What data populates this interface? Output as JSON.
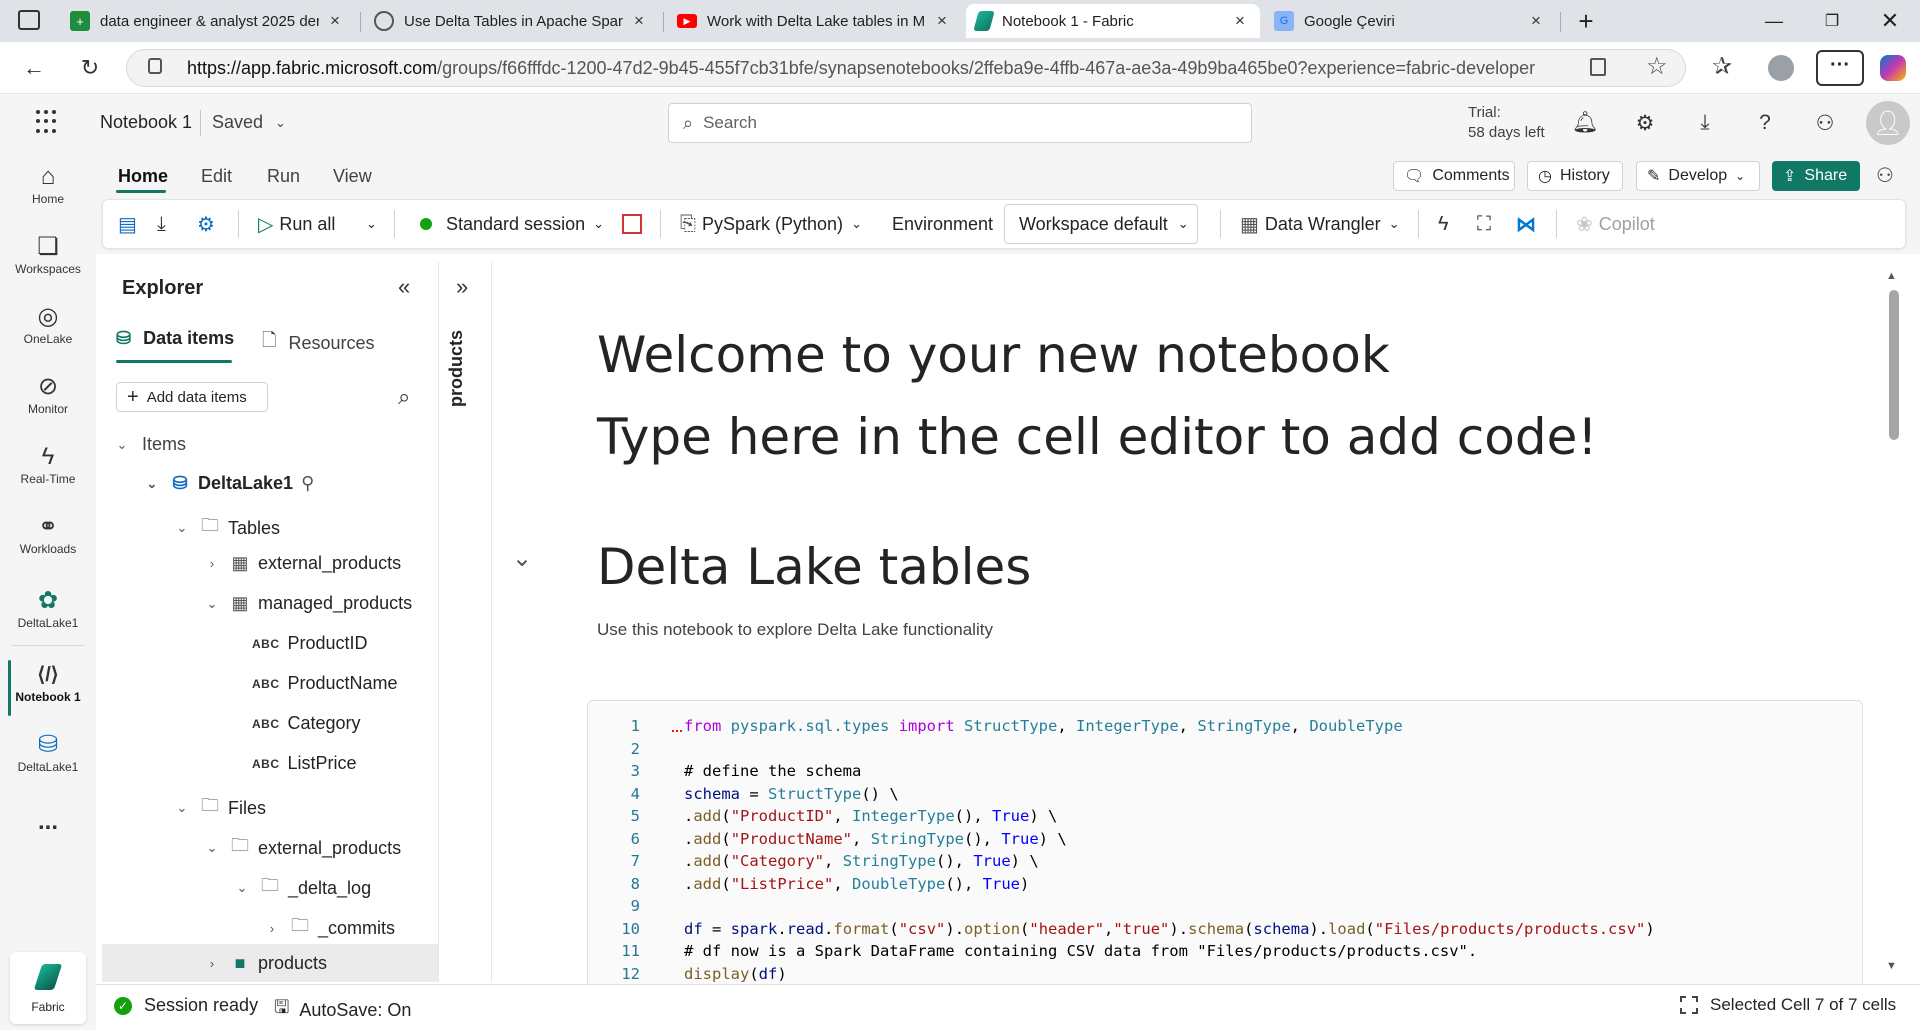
{
  "browser": {
    "tabs": [
      {
        "title": "data engineer & analyst 2025 den",
        "icon": "sheets-icon",
        "color": "#1e8e3e"
      },
      {
        "title": "Use Delta Tables in Apache Spark",
        "icon": "globe-icon",
        "color": "#555555"
      },
      {
        "title": "Work with Delta Lake tables in Mi",
        "icon": "youtube-icon",
        "color": "#ff0000"
      },
      {
        "title": "Notebook 1 - Fabric",
        "icon": "fabric-icon",
        "color": "#117865"
      },
      {
        "title": "Google Çeviri",
        "icon": "translate-icon",
        "color": "#4285f4"
      }
    ],
    "url_domain": "https://app.fabric.microsoft.com",
    "url_path": "/groups/f66fffdc-1200-47d2-9b45-455f7cb31bfe/synapsenotebooks/2ffeba9e-4ffb-467a-ae3a-49b9ba465be0?experience=fabric-developer"
  },
  "header": {
    "notebook_title": "Notebook 1",
    "save_state": "Saved",
    "search_placeholder": "Search",
    "trial_label": "Trial:",
    "trial_days": "58 days left"
  },
  "rail": {
    "items": [
      {
        "label": "Home",
        "icon": "home-icon"
      },
      {
        "label": "Workspaces",
        "icon": "workspaces-icon"
      },
      {
        "label": "OneLake",
        "icon": "onelake-icon"
      },
      {
        "label": "Monitor",
        "icon": "monitor-icon"
      },
      {
        "label": "Real-Time",
        "icon": "realtime-icon"
      },
      {
        "label": "Workloads",
        "icon": "workloads-icon"
      },
      {
        "label": "DeltaLake1",
        "icon": "lakehouse-icon"
      },
      {
        "label": "Notebook 1",
        "icon": "notebook-icon"
      },
      {
        "label": "DeltaLake1",
        "icon": "lakehouse-icon"
      }
    ],
    "more": "...",
    "fabric_label": "Fabric"
  },
  "ribbon": {
    "tabs": [
      "Home",
      "Edit",
      "Run",
      "View"
    ],
    "comments": "Comments",
    "history": "History",
    "develop": "Develop",
    "share": "Share",
    "run_all": "Run all",
    "session": "Standard session",
    "language": "PySpark (Python)",
    "environment": "Environment",
    "workspace": "Workspace default",
    "data_wrangler": "Data Wrangler",
    "copilot": "Copilot"
  },
  "explorer": {
    "title": "Explorer",
    "tab_data": "Data items",
    "tab_resources": "Resources",
    "add_button": "Add data items",
    "items_label": "Items",
    "lakehouse": "DeltaLake1",
    "tables_label": "Tables",
    "table_external": "external_products",
    "table_managed": "managed_products",
    "columns": [
      "ProductID",
      "ProductName",
      "Category",
      "ListPrice"
    ],
    "column_type": "ABC",
    "files_label": "Files",
    "folder_external": "external_products",
    "folder_delta_log": "_delta_log",
    "folder_commits": "_commits",
    "folder_products": "products"
  },
  "sidepanel": {
    "label": "products"
  },
  "notebook": {
    "welcome_line1": "Welcome to your new notebook",
    "welcome_line2": "Type here in the cell editor to add code!",
    "section_title": "Delta Lake tables",
    "section_desc": "Use this notebook to explore Delta Lake functionality",
    "code_line_numbers": [
      "1",
      "2",
      "3",
      "4",
      "5",
      "6",
      "7",
      "8",
      "9",
      "10",
      "11",
      "12"
    ]
  },
  "status": {
    "session": "Session ready",
    "autosave": "AutoSave: On",
    "selected": "Selected Cell 7 of 7 cells"
  },
  "colors": {
    "accent": "#117865",
    "link": "#0f6cbd"
  }
}
